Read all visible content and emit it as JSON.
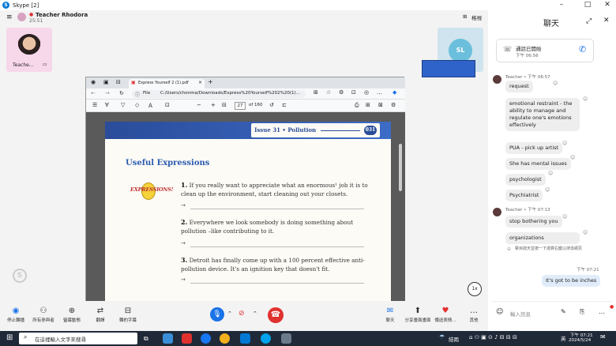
{
  "window": {
    "title": "Skype [2]",
    "minimize": "–",
    "maximize": "□",
    "close": "✕"
  },
  "call": {
    "host_name": "Teacher Rhodora",
    "duration": "25:51",
    "switch_label": "格視",
    "self_thumb_label": "Teache...",
    "remote_initials": "SL"
  },
  "pdf": {
    "tab_title": "Express Yourself 2 (1).pdf",
    "file_label": "File",
    "address": "C:/Users/chonma/Downloads/Express%20Yourself%202%20(1)...",
    "page_number": "27",
    "page_total": "of 160",
    "banner_label": "Issue 31 • Pollution",
    "banner_badge": "031",
    "heading": "Useful Expressions",
    "logo_text": "EXPRESSIONS!",
    "questions": [
      {
        "num": "1.",
        "text": "If you really want to appreciate what an enormous¹ job it is to clean up the environment, start cleaning out your closets."
      },
      {
        "num": "2.",
        "text": "Everywhere we look somebody is doing something about pollution –like contributing to it."
      },
      {
        "num": "3.",
        "text": "Detroit has finally come up with a 100 percent effective anti-pollution device. It's an ignition key that doesn't fit."
      }
    ],
    "arrow": "→"
  },
  "zoom_badge": "1x",
  "bottom_controls": [
    {
      "label": "停止轉播",
      "icon": "◉"
    },
    {
      "label": "所有參與者",
      "icon": "⚇"
    },
    {
      "label": "螢幕動態",
      "icon": "⊕"
    },
    {
      "label": "翻譯",
      "icon": "⇄"
    },
    {
      "label": "轉的字幕",
      "icon": "⊟"
    }
  ],
  "bottom_right_controls": [
    {
      "label": "聊天",
      "icon": "✉"
    },
    {
      "label": "分享畫面畫面",
      "icon": "⬆"
    },
    {
      "label": "傳送表情…",
      "icon": "♥"
    },
    {
      "label": "其他",
      "icon": "…"
    }
  ],
  "chat": {
    "header": "聊天",
    "call_started": "通話已開始",
    "call_time": "下午 06:56",
    "msg_group1_meta": "Teacher • 下午 06:57",
    "msg_group1": [
      "request",
      "emotional restraint - the ability to manage and regulate one's emotions effectively",
      "PUA - pick up artist",
      "She has mental issues",
      "psychologist",
      "Psychiatrist"
    ],
    "msg_group2_meta": "Teacher • 下午 07:13",
    "msg_group2": [
      "stop bothering you",
      "organizations"
    ],
    "notice": "擊目撥天並按一下運算右鍵以搜尋網頁",
    "own_time": "下午 07:21",
    "own_msg": "It's got to be inches",
    "input_placeholder": "輸入訊息"
  },
  "taskbar": {
    "search_placeholder": "在這裡輸入文字來搜尋",
    "weather": "結雨",
    "time": "下午 07:21",
    "date": "2024/5/24",
    "lang": "英"
  }
}
